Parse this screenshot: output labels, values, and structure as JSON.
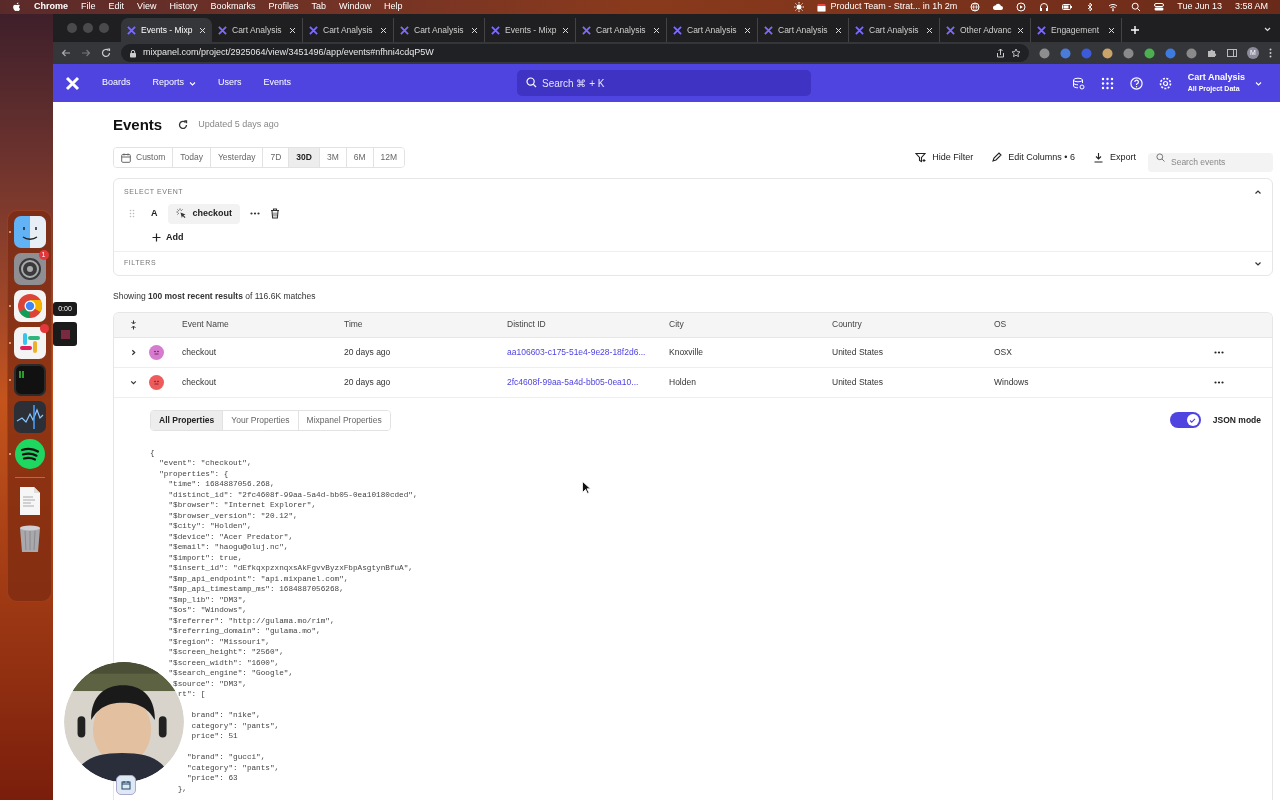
{
  "menubar": {
    "app": "Chrome",
    "menus": [
      "File",
      "Edit",
      "View",
      "History",
      "Bookmarks",
      "Profiles",
      "Tab",
      "Window",
      "Help"
    ],
    "event_reminder": "Product Team - Strat... in 1h 2m",
    "date": "Tue Jun 13",
    "time": "3:58 AM"
  },
  "browser": {
    "tabs": [
      {
        "title": "Events - Mixp",
        "selected": true
      },
      {
        "title": "Cart Analysis",
        "selected": false
      },
      {
        "title": "Cart Analysis",
        "selected": false
      },
      {
        "title": "Cart Analysis",
        "selected": false
      },
      {
        "title": "Events - Mixp",
        "selected": false
      },
      {
        "title": "Cart Analysis",
        "selected": false
      },
      {
        "title": "Cart Analysis",
        "selected": false
      },
      {
        "title": "Cart Analysis",
        "selected": false
      },
      {
        "title": "Cart Analysis",
        "selected": false
      },
      {
        "title": "Other Advanc",
        "selected": false
      },
      {
        "title": "Engagement",
        "selected": false
      }
    ],
    "url": "mixpanel.com/project/2925064/view/3451496/app/events#nfhni4cdqP5W",
    "profile": "M"
  },
  "nav": {
    "items": [
      {
        "label": "Boards",
        "dropdown": false
      },
      {
        "label": "Reports",
        "dropdown": true
      },
      {
        "label": "Users",
        "dropdown": false
      },
      {
        "label": "Events",
        "dropdown": false
      }
    ],
    "search_placeholder": "Search ⌘ + K",
    "project": "Cart Analysis",
    "project_scope": "All Project Data"
  },
  "page": {
    "title": "Events",
    "updated": "Updated 5 days ago",
    "ranges": [
      {
        "label": "Custom",
        "selected": false
      },
      {
        "label": "Today",
        "selected": false
      },
      {
        "label": "Yesterday",
        "selected": false
      },
      {
        "label": "7D",
        "selected": false
      },
      {
        "label": "30D",
        "selected": true
      },
      {
        "label": "3M",
        "selected": false
      },
      {
        "label": "6M",
        "selected": false
      },
      {
        "label": "12M",
        "selected": false
      }
    ],
    "actions": [
      {
        "kind": "filter",
        "label": "Hide Filter"
      },
      {
        "kind": "columns",
        "label": "Edit Columns • 6"
      },
      {
        "kind": "export",
        "label": "Export"
      }
    ],
    "search_placeholder": "Search events"
  },
  "select_event": {
    "heading": "SELECT EVENT",
    "letter": "A",
    "event": "checkout",
    "add": "Add",
    "filters": "FILTERS"
  },
  "results": "Showing **100 most recent results** of 116.6K matches",
  "table": {
    "columns": [
      "Event Name",
      "Time",
      "Distinct ID",
      "City",
      "Country",
      "OS"
    ],
    "rows": [
      {
        "event": "checkout",
        "time": "20 days ago",
        "distinct_id": "aa106603-c175-51e4-9e28-18f2d6...",
        "city": "Knoxville",
        "country": "United States",
        "os": "OSX",
        "color": "#d77bd0",
        "expanded": false
      },
      {
        "event": "checkout",
        "time": "20 days ago",
        "distinct_id": "2fc4608f-99aa-5a4d-bb05-0ea10...",
        "city": "Holden",
        "country": "United States",
        "os": "Windows",
        "color": "#ef5b5b",
        "expanded": true
      }
    ]
  },
  "details": {
    "tabs": [
      {
        "label": "All Properties",
        "selected": true
      },
      {
        "label": "Your Properties",
        "selected": false
      },
      {
        "label": "Mixpanel Properties",
        "selected": false
      }
    ],
    "json_mode": {
      "label": "JSON mode",
      "on": true
    },
    "json_blocks": [
      [
        "{",
        "  \"event\": \"checkout\",",
        "  \"properties\": {",
        "    \"time\": 1684887056.268,",
        "    \"distinct_id\": \"2fc4608f-99aa-5a4d-bb05-0ea10180cded\",",
        "    \"$browser\": \"Internet Explorer\",",
        "    \"$browser_version\": \"20.12\",",
        "    \"$city\": \"Holden\",",
        "    \"$device\": \"Acer Predator\",",
        "    \"$email\": \"haogu@oluj.nc\",",
        "    \"$import\": true,",
        "    \"$insert_id\": \"dEfkqxpzxnqxsAkFgvvByzxFbpAsgtynBfuA\",",
        "    \"$mp_api_endpoint\": \"api.mixpanel.com\",",
        "    \"$mp_api_timestamp_ms\": 1684887056268,",
        "    \"$mp_lib\": \"DM3\",",
        "    \"$os\": \"Windows\",",
        "    \"$referrer\": \"http://gulama.mo/rim\",",
        "    \"$referring_domain\": \"gulama.mo\",",
        "    \"$region\": \"Missouri\",",
        "    \"$screen_height\": \"2560\",",
        "    \"$screen_width\": \"1600\",",
        "    \"$search_engine\": \"Google\",",
        "     $source\": \"DM3\",",
        "      rt\": ["
      ],
      [
        "         brand\": \"nike\",",
        "         category\": \"pants\",",
        "         price\": 51"
      ],
      [
        "        \"brand\": \"gucci\",",
        "        \"category\": \"pants\",",
        "        \"price\": 63",
        "      },"
      ]
    ]
  },
  "dock": {
    "apps": [
      {
        "kind": "finder",
        "running": true,
        "alert": false
      },
      {
        "kind": "settings",
        "running": false,
        "alert": false,
        "badge": "1"
      },
      {
        "kind": "chrome",
        "running": true,
        "alert": false
      },
      {
        "kind": "slack",
        "running": true,
        "alert": true
      },
      {
        "kind": "terminal",
        "running": true,
        "alert": false
      },
      {
        "kind": "activity",
        "running": false,
        "alert": false
      },
      {
        "kind": "spotify",
        "running": true,
        "alert": false
      },
      {
        "kind": "separator"
      },
      {
        "kind": "document",
        "running": false,
        "alert": false
      },
      {
        "kind": "trash",
        "running": false,
        "alert": false
      }
    ]
  },
  "recorder": {
    "time": "0:00"
  }
}
